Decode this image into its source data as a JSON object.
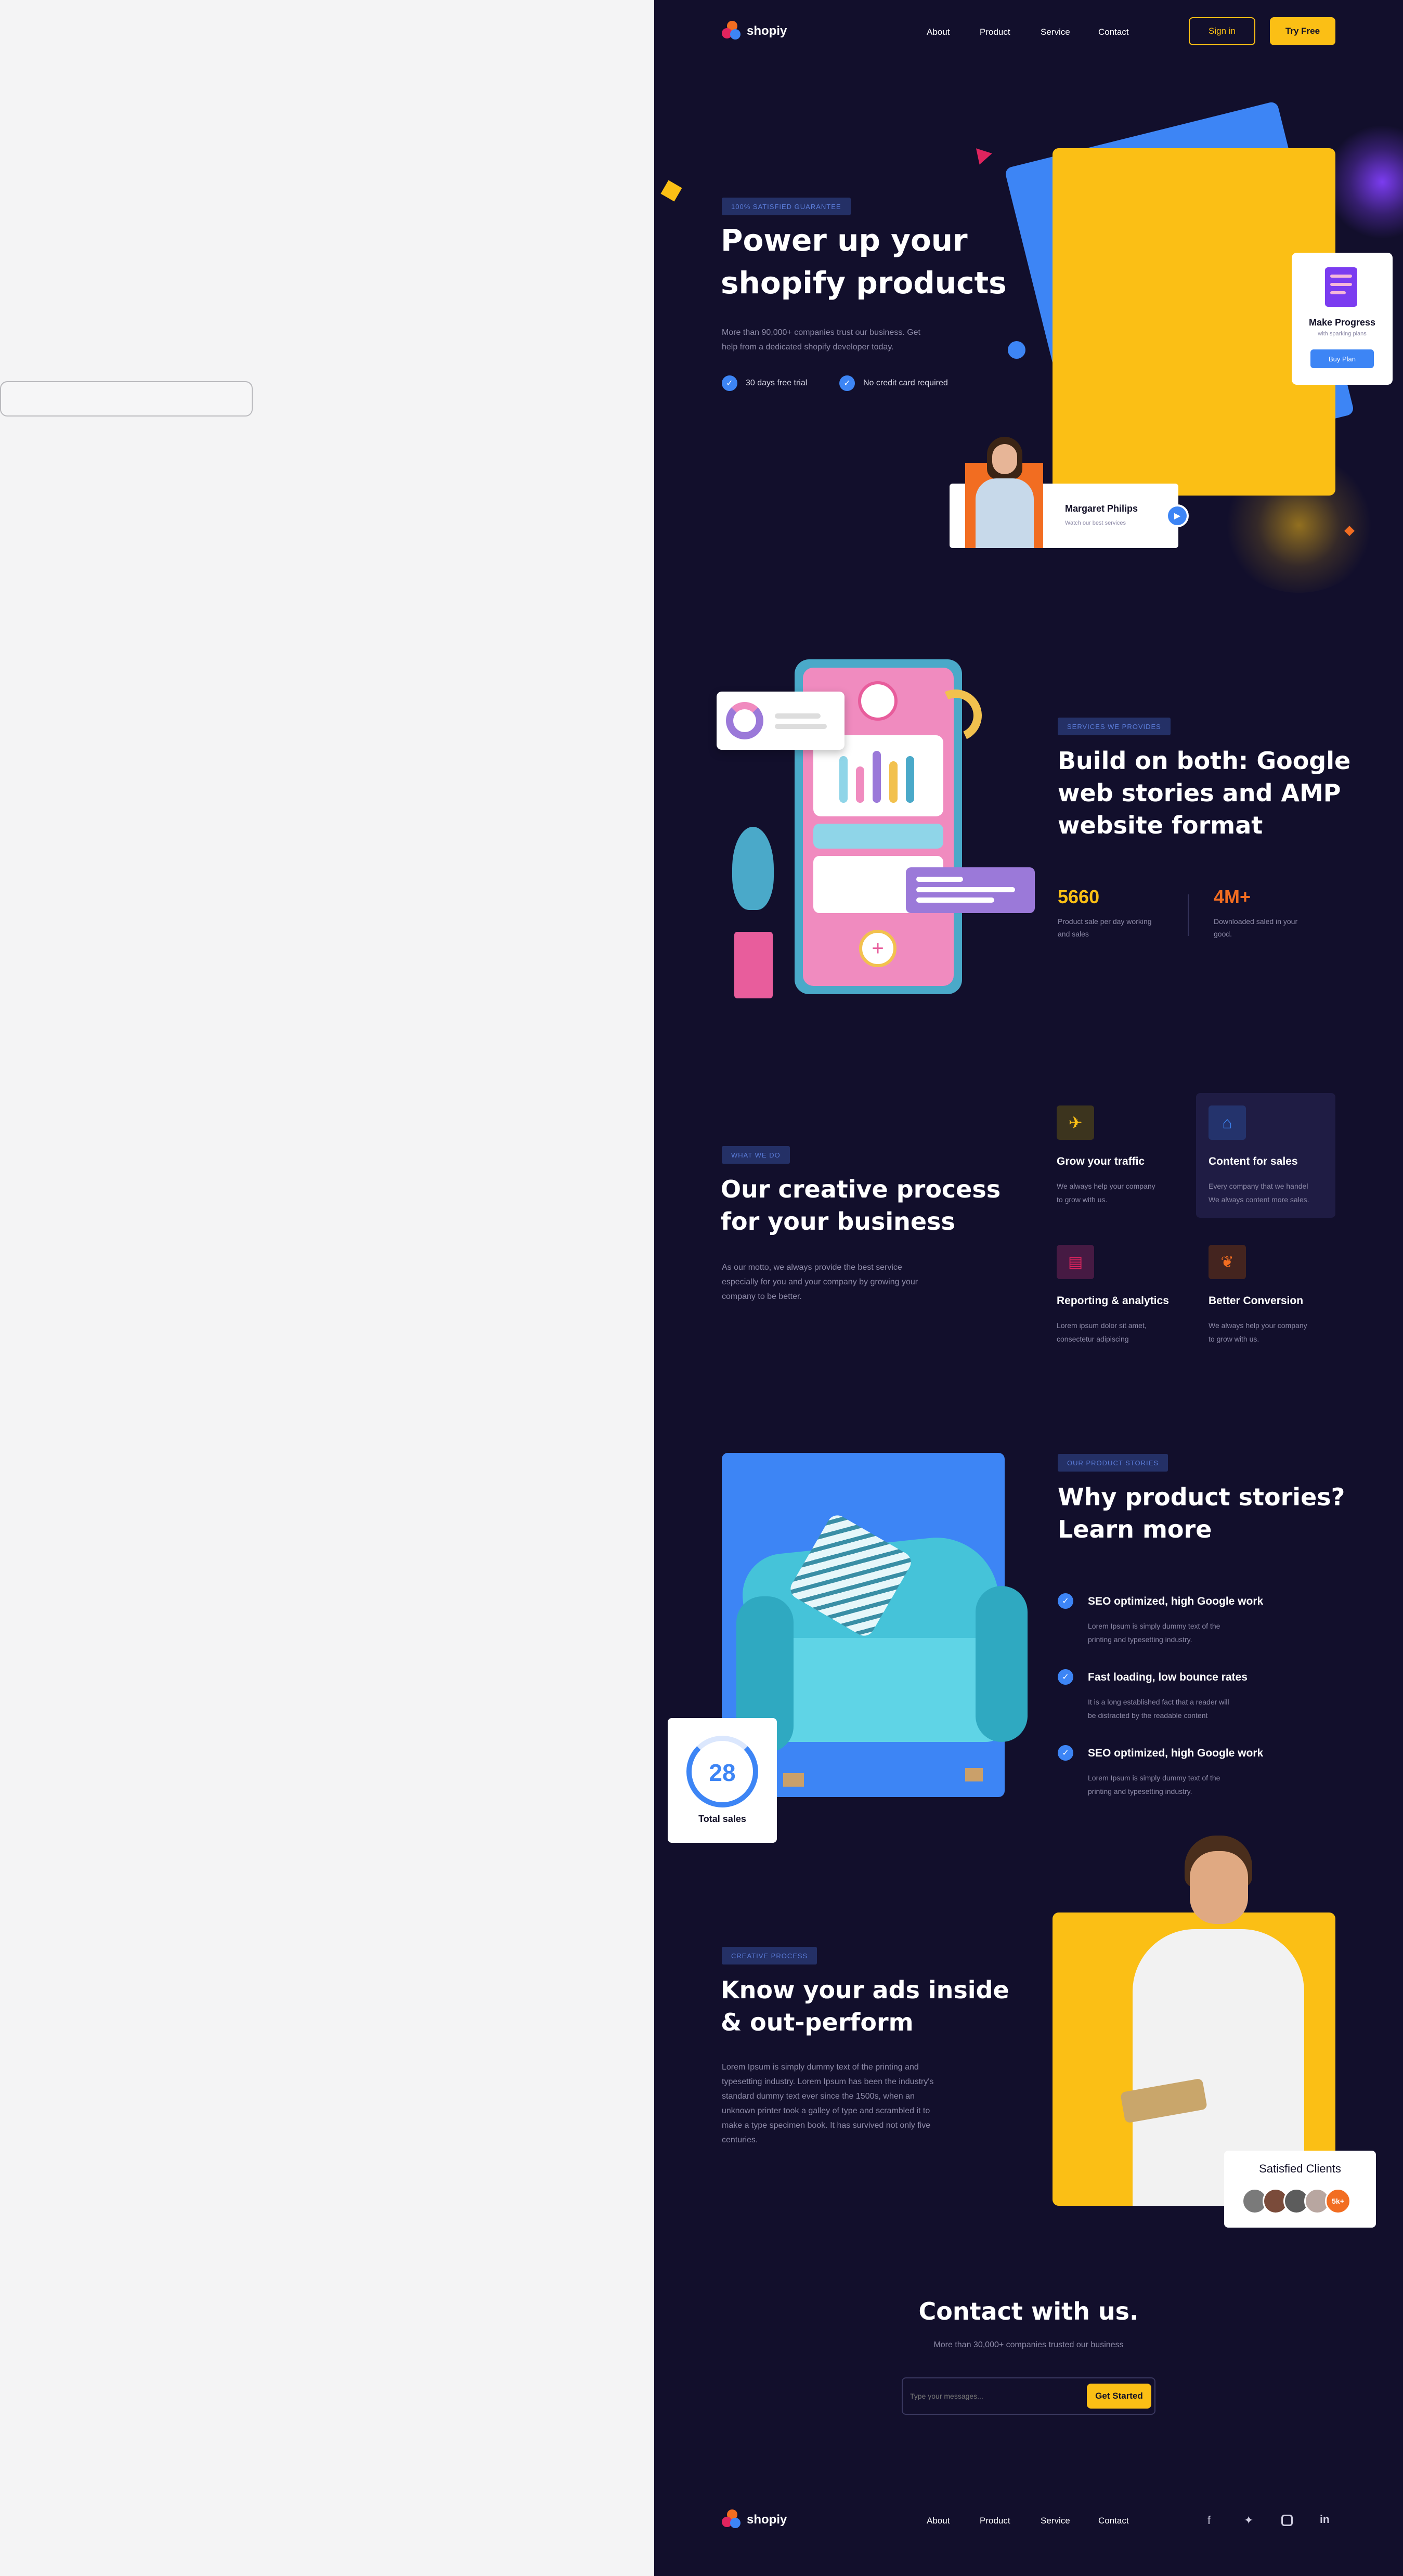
{
  "nav": {
    "brand": "shopiy",
    "links": [
      "About",
      "Product",
      "Service",
      "Contact"
    ],
    "signin": "Sign in",
    "try_free": "Try Free"
  },
  "hero": {
    "tag": "100% SATISFIED GUARANTEE",
    "title_line1": "Power up your",
    "title_line2": "shopify products",
    "subtitle_line1": "More than 90,000+ companies trust our business. Get",
    "subtitle_line2": "help from a dedicated shopify developer today.",
    "perk1": "30 days free trial",
    "perk2": "No credit card required",
    "progress_card": {
      "title": "Make Progress",
      "subtitle": "with sparking plans",
      "button": "Buy Plan"
    },
    "testimonial": {
      "name": "Margaret Philips",
      "subtitle": "Watch our best services"
    }
  },
  "services": {
    "tag": "SERVICES WE PROVIDES",
    "title_line1": "Build on both: Google",
    "title_line2": "web stories and AMP",
    "title_line3": "website format",
    "stats": [
      {
        "value": "5660",
        "label_line1": "Product sale per day working",
        "label_line2": "and sales",
        "color": "#fbbf15"
      },
      {
        "value": "4M+",
        "label_line1": "Downloaded saled in your",
        "label_line2": "good.",
        "color": "#f26d21"
      }
    ]
  },
  "process": {
    "tag": "WHAT WE DO",
    "title_line1": "Our creative process",
    "title_line2": "for your business",
    "text_line1": "As our motto, we always provide the best service",
    "text_line2": "especially for you and your company by growing your",
    "text_line3": "company to be better.",
    "items": [
      {
        "title": "Grow your traffic",
        "line1": "We always help your company",
        "line2": "to grow with us.",
        "icon": "rocket-icon"
      },
      {
        "title": "Content for sales",
        "line1": "Every company that we handel",
        "line2": "We always content more sales.",
        "icon": "tag-icon"
      },
      {
        "title": "Reporting & analytics",
        "line1": "Lorem ipsum dolor sit amet,",
        "line2": "consectetur adipiscing",
        "icon": "document-icon"
      },
      {
        "title": "Better Conversion",
        "line1": "We always help your company",
        "line2": "to grow with us.",
        "icon": "conversion-icon"
      }
    ]
  },
  "stories": {
    "tag": "OUR PRODUCT STORIES",
    "title_line1": "Why product stories?",
    "title_line2": "Learn more",
    "total_sales_value": "28",
    "total_sales_label": "Total sales",
    "features": [
      {
        "title": "SEO optimized, high Google work",
        "line1": "Lorem Ipsum is simply dummy text of the",
        "line2": "printing and typesetting industry."
      },
      {
        "title": "Fast loading, low bounce rates",
        "line1": "It is a long established fact that a reader will",
        "line2": "be distracted by the readable content"
      },
      {
        "title": "SEO optimized, high Google work",
        "line1": "Lorem Ipsum is simply dummy text of the",
        "line2": "printing and typesetting industry."
      }
    ]
  },
  "ads": {
    "tag": "CREATIVE PROCESS",
    "title_line1": "Know your ads inside",
    "title_line2": "& out-perform",
    "lines": [
      "Lorem Ipsum is simply dummy text of the printing and",
      "typesetting industry. Lorem Ipsum has been the industry's",
      "standard dummy text ever since the 1500s, when an",
      "unknown printer took a galley of type and scrambled it to",
      "make a type specimen book. It has survived not only five",
      "centuries."
    ],
    "clients_title": "Satisfied Clients",
    "clients_count": "5k+"
  },
  "contact": {
    "title": "Contact with us.",
    "subtitle": "More than 30,000+ companies trusted our business",
    "placeholder": "Type your messages...",
    "button": "Get Started"
  },
  "footer": {
    "brand": "shopiy",
    "links": [
      "About",
      "Product",
      "Service",
      "Contact"
    ],
    "social": [
      "facebook-icon",
      "twitter-icon",
      "instagram-icon",
      "linkedin-icon"
    ]
  },
  "colors": {
    "background": "#120f2c",
    "accent_yellow": "#fbbf15",
    "accent_blue": "#3d85f5",
    "accent_orange": "#f26d21"
  }
}
